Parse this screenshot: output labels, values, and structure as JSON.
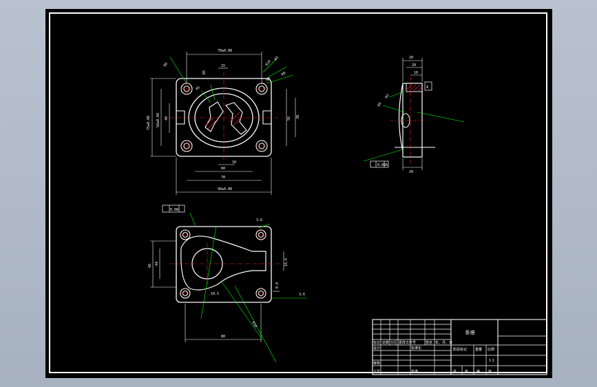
{
  "drawing": {
    "title": "卧座",
    "scale": "1:1"
  },
  "dimensions": {
    "top_view": {
      "overall_top": "70±0.08",
      "overall_bottom": "90±0.08",
      "w70": "70",
      "w40": "40",
      "w60": "60",
      "w10": "10",
      "w15": "15",
      "h75": "75±0.08",
      "h58": "58±0.08",
      "h40": "40",
      "h56": "56",
      "h30": "30",
      "r1": "R6",
      "r2": "R10",
      "r3": "R3",
      "r4": "R8",
      "r5": "R5",
      "r6": "R5",
      "r7": "R8"
    },
    "side_view": {
      "d1": "20",
      "d2": "20",
      "d3": "10",
      "d4": "R3",
      "d5": "R5",
      "d6": "20",
      "datum": "A",
      "tol": "0.08",
      "bottom": "20"
    },
    "front_view": {
      "tol_box": "0.08",
      "h48": "48",
      "h44": "44",
      "d16": "16.4",
      "d3a": "3.6",
      "d3b": "3.6",
      "w80": "80",
      "r10": "10.5",
      "slope": "R10",
      "tol_right": "0.8"
    }
  },
  "title_block": {
    "row_headers": [
      "标记",
      "处数",
      "分区",
      "更改文件号",
      "签名",
      "年、月、日"
    ],
    "left_labels": [
      "设计",
      "审核",
      "工艺"
    ],
    "mid_labels": [
      "标准化",
      "批准"
    ],
    "stage_headers": [
      "阶段标记",
      "重量",
      "比例"
    ],
    "sheet_labels": [
      "共",
      "张",
      "第",
      "张"
    ]
  }
}
